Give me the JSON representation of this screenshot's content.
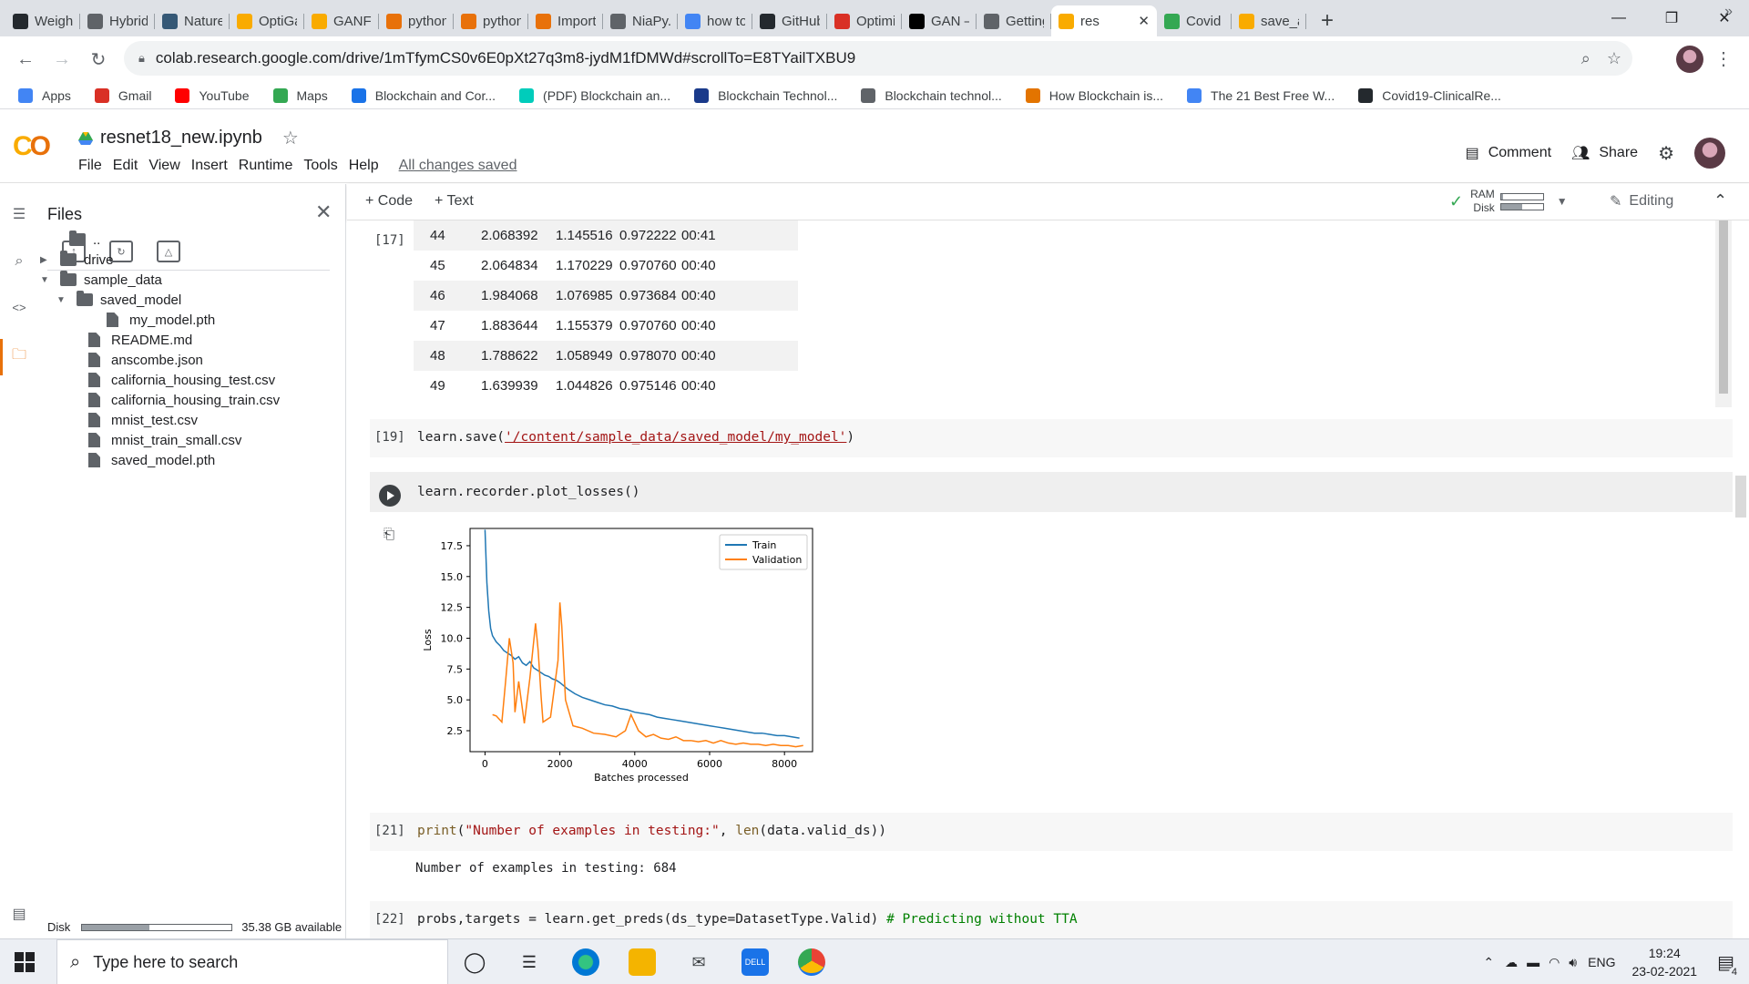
{
  "browser": {
    "tabs": [
      {
        "label": "Weigh",
        "icon": "github-icon",
        "color": "#24292e"
      },
      {
        "label": "Hybrid",
        "icon": "colab-doc-icon",
        "color": "#5f6368"
      },
      {
        "label": "Nature",
        "icon": "tds-icon",
        "color": "#355876"
      },
      {
        "label": "OptiGa",
        "icon": "colab-icon",
        "color": "#f9ab00"
      },
      {
        "label": "GANFi",
        "icon": "colab-icon",
        "color": "#f9ab00"
      },
      {
        "label": "python",
        "icon": "python-icon",
        "color": "#e8710a"
      },
      {
        "label": "python",
        "icon": "python-icon",
        "color": "#e8710a"
      },
      {
        "label": "Import",
        "icon": "python-icon",
        "color": "#e8710a"
      },
      {
        "label": "NiaPy.",
        "icon": "docs-icon",
        "color": "#5f6368"
      },
      {
        "label": "how to",
        "icon": "google-icon",
        "color": "#4285f4"
      },
      {
        "label": "GitHub",
        "icon": "github-icon",
        "color": "#24292e"
      },
      {
        "label": "Optimi",
        "icon": "k-icon",
        "color": "#d93025"
      },
      {
        "label": "GAN –",
        "icon": "medium-icon",
        "color": "#000000"
      },
      {
        "label": "Getting",
        "icon": "docs-icon",
        "color": "#5f6368"
      },
      {
        "label": "res",
        "icon": "colab-icon",
        "color": "#f9ab00",
        "active": true
      },
      {
        "label": "Covid",
        "icon": "drive-icon",
        "color": "#34a853"
      },
      {
        "label": "save_a",
        "icon": "colab-icon",
        "color": "#f9ab00"
      }
    ],
    "new_tab": "+",
    "url": "colab.research.google.com/drive/1mTfymCS0v6E0pXt27q3m8-jydM1fDMWd#scrollTo=E8TYailTXBU9",
    "bookmarks": [
      {
        "label": "Apps",
        "icon": "apps-grid-icon",
        "color": "#4285f4"
      },
      {
        "label": "Gmail",
        "icon": "gmail-icon",
        "color": "#d93025"
      },
      {
        "label": "YouTube",
        "icon": "youtube-icon",
        "color": "#ff0000"
      },
      {
        "label": "Maps",
        "icon": "maps-icon",
        "color": "#34a853"
      },
      {
        "label": "Blockchain and Cor...",
        "icon": "elsevier-icon",
        "color": "#1a73e8"
      },
      {
        "label": "(PDF) Blockchain an...",
        "icon": "researchgate-icon",
        "color": "#00ccbb"
      },
      {
        "label": "Blockchain Technol...",
        "icon": "ieee-icon",
        "color": "#1a3a8a"
      },
      {
        "label": "Blockchain technol...",
        "icon": "doc-icon",
        "color": "#5f6368"
      },
      {
        "label": "How Blockchain is...",
        "icon": "bulb-icon",
        "color": "#e37400"
      },
      {
        "label": "The 21 Best Free W...",
        "icon": "flask-icon",
        "color": "#4285f4"
      },
      {
        "label": "Covid19-ClinicalRe...",
        "icon": "github-icon",
        "color": "#24292e"
      }
    ],
    "bookmarks_more": "»"
  },
  "colab": {
    "notebook_title": "resnet18_new.ipynb",
    "menus": [
      "File",
      "Edit",
      "View",
      "Insert",
      "Runtime",
      "Tools",
      "Help"
    ],
    "save_status": "All changes saved",
    "comment_label": "Comment",
    "share_label": "Share",
    "toolbar": {
      "add_code": "+ Code",
      "add_text": "+ Text",
      "ram_label": "RAM",
      "disk_label": "Disk",
      "ram_fraction": 0.05,
      "disk_fraction": 0.5,
      "editing_label": "Editing"
    }
  },
  "files_panel": {
    "title": "Files",
    "tree": [
      {
        "label": "..",
        "type": "up",
        "depth": 0
      },
      {
        "label": "drive",
        "type": "folder",
        "depth": 0,
        "caret": "right"
      },
      {
        "label": "sample_data",
        "type": "folder",
        "depth": 0,
        "caret": "down"
      },
      {
        "label": "saved_model",
        "type": "folder",
        "depth": 1,
        "caret": "down"
      },
      {
        "label": "my_model.pth",
        "type": "file",
        "depth": 2
      },
      {
        "label": "README.md",
        "type": "file",
        "depth": 1
      },
      {
        "label": "anscombe.json",
        "type": "file",
        "depth": 1
      },
      {
        "label": "california_housing_test.csv",
        "type": "file",
        "depth": 1
      },
      {
        "label": "california_housing_train.csv",
        "type": "file",
        "depth": 1
      },
      {
        "label": "mnist_test.csv",
        "type": "file",
        "depth": 1
      },
      {
        "label": "mnist_train_small.csv",
        "type": "file",
        "depth": 1
      },
      {
        "label": "saved_model.pth",
        "type": "file",
        "depth": 1
      }
    ],
    "disk_label": "Disk",
    "disk_fraction": 0.45,
    "disk_available": "35.38 GB available"
  },
  "cells": {
    "cell17": {
      "exec": "[17]",
      "rows": [
        [
          "44",
          "2.068392",
          "1.145516",
          "0.972222",
          "00:41"
        ],
        [
          "45",
          "2.064834",
          "1.170229",
          "0.970760",
          "00:40"
        ],
        [
          "46",
          "1.984068",
          "1.076985",
          "0.973684",
          "00:40"
        ],
        [
          "47",
          "1.883644",
          "1.155379",
          "0.970760",
          "00:40"
        ],
        [
          "48",
          "1.788622",
          "1.058949",
          "0.978070",
          "00:40"
        ],
        [
          "49",
          "1.639939",
          "1.044826",
          "0.975146",
          "00:40"
        ]
      ]
    },
    "cell19": {
      "exec": "[19]",
      "code_prefix": "learn.save(",
      "code_string": "'/content/sample_data/saved_model/my_model'",
      "code_suffix": ")"
    },
    "cell_plot": {
      "code": "learn.recorder.plot_losses()"
    },
    "cell21": {
      "exec": "[21]",
      "code_fn": "print",
      "code_open": "(",
      "code_string": "\"Number of examples in testing:\"",
      "code_mid": ", ",
      "code_fn2": "len",
      "code_rest": "(data.valid_ds))",
      "output": "Number of examples in testing: 684"
    },
    "cell22": {
      "exec": "[22]",
      "code": "probs,targets = learn.get_preds(ds_type=DatasetType.Valid) ",
      "comment": "# Predicting without TTA"
    }
  },
  "chart_data": {
    "type": "line",
    "xlabel": "Batches processed",
    "ylabel": "Loss",
    "xlim": [
      -400,
      8750
    ],
    "ylim": [
      0.8,
      18.9
    ],
    "xticks": [
      0,
      2000,
      4000,
      6000,
      8000
    ],
    "yticks": [
      2.5,
      5.0,
      7.5,
      10.0,
      12.5,
      15.0,
      17.5
    ],
    "legend_position": "top-right",
    "series": [
      {
        "name": "Train",
        "color": "#1f77b4",
        "x": [
          0,
          50,
          100,
          150,
          200,
          300,
          400,
          500,
          600,
          700,
          800,
          900,
          1000,
          1100,
          1200,
          1300,
          1400,
          1500,
          1600,
          1700,
          1800,
          1900,
          2000,
          2200,
          2400,
          2600,
          2800,
          3000,
          3200,
          3400,
          3600,
          3800,
          4000,
          4200,
          4400,
          4600,
          4800,
          5000,
          5200,
          5400,
          5600,
          5800,
          6000,
          6200,
          6400,
          6600,
          6800,
          7000,
          7200,
          7400,
          7600,
          7800,
          8000,
          8200,
          8400
        ],
        "values": [
          18.8,
          14.5,
          12.2,
          10.8,
          10.2,
          9.7,
          9.4,
          9.0,
          8.8,
          8.6,
          8.3,
          8.5,
          8.0,
          7.8,
          8.1,
          7.6,
          7.4,
          7.2,
          7.0,
          6.9,
          6.7,
          6.6,
          6.4,
          5.9,
          5.5,
          5.2,
          5.0,
          4.8,
          4.6,
          4.5,
          4.3,
          4.2,
          4.0,
          3.9,
          3.8,
          3.6,
          3.5,
          3.4,
          3.3,
          3.2,
          3.1,
          3.0,
          2.9,
          2.8,
          2.7,
          2.6,
          2.5,
          2.4,
          2.3,
          2.3,
          2.2,
          2.1,
          2.1,
          2.0,
          1.9
        ]
      },
      {
        "name": "Validation",
        "color": "#ff7f0e",
        "x": [
          200,
          300,
          450,
          550,
          650,
          700,
          750,
          800,
          900,
          1050,
          1200,
          1350,
          1420,
          1500,
          1550,
          1750,
          1950,
          2000,
          2050,
          2150,
          2350,
          2600,
          2900,
          3200,
          3500,
          3750,
          3900,
          4100,
          4300,
          4500,
          4700,
          4900,
          5100,
          5300,
          5500,
          5700,
          5900,
          6100,
          6300,
          6500,
          6700,
          6900,
          7100,
          7300,
          7500,
          7700,
          7900,
          8100,
          8300,
          8500
        ],
        "values": [
          3.8,
          3.7,
          3.2,
          6.5,
          10.0,
          9.0,
          8.0,
          4.0,
          6.5,
          3.1,
          6.8,
          11.2,
          9.0,
          5.2,
          3.2,
          3.6,
          8.2,
          12.9,
          11.0,
          5.0,
          2.9,
          2.7,
          2.3,
          2.2,
          2.0,
          2.5,
          3.8,
          2.5,
          2.0,
          2.2,
          1.9,
          1.8,
          2.0,
          1.7,
          1.7,
          1.6,
          1.7,
          1.5,
          1.7,
          1.5,
          1.4,
          1.5,
          1.4,
          1.4,
          1.3,
          1.4,
          1.3,
          1.3,
          1.2,
          1.3
        ]
      }
    ]
  },
  "taskbar": {
    "search_placeholder": "Type here to search",
    "language": "ENG",
    "time": "19:24",
    "date": "23-02-2021",
    "notifications": "4"
  }
}
